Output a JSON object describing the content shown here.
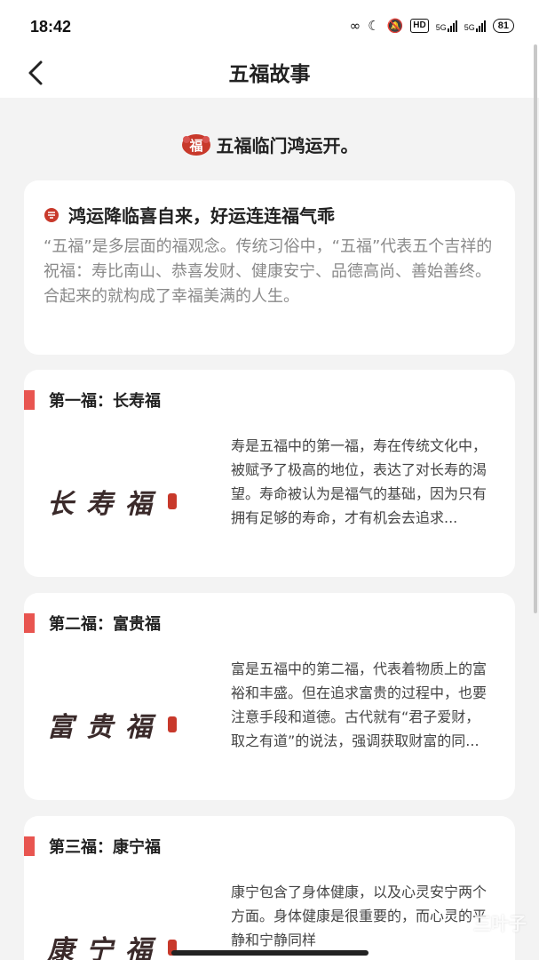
{
  "status": {
    "time": "18:42",
    "hd": "HD",
    "net1": "5G",
    "net2": "5G",
    "battery": "81"
  },
  "nav": {
    "title": "五福故事"
  },
  "banner": {
    "text": "五福临门鸿运开。",
    "badge_char": "福"
  },
  "intro": {
    "title": "鸿运降临喜自来，好运连连福气乖",
    "text": "“五福”是多层面的福观念。传统习俗中，“五福”代表五个吉祥的祝福：寿比南山、恭喜发财、健康安宁、品德高尚、善始善终。合起来的就构成了幸福美满的人生。"
  },
  "fu_items": [
    {
      "name": "第一福：长寿福",
      "calli": [
        "长",
        "寿",
        "福"
      ],
      "text": "寿是五福中的第一福，寿在传统文化中，被赋予了极高的地位，表达了对长寿的渴望。寿命被认为是福气的基础，因为只有拥有足够的寿命，才有机会去追求..."
    },
    {
      "name": "第二福：富贵福",
      "calli": [
        "富",
        "贵",
        "福"
      ],
      "text": "富是五福中的第二福，代表着物质上的富裕和丰盛。但在追求富贵的过程中，也要注意手段和道德。古代就有“君子爱财，取之有道”的说法，强调获取财富的同..."
    },
    {
      "name": "第三福：康宁福",
      "calli": [
        "康",
        "宁",
        "福"
      ],
      "text": "康宁包含了身体健康，以及心灵安宁两个方面。身体健康是很重要的，而心灵的平静和宁静同样"
    }
  ],
  "watermark": "三叶子",
  "colors": {
    "accent": "#e85550",
    "background": "#f3f3f3",
    "card": "#ffffff"
  }
}
